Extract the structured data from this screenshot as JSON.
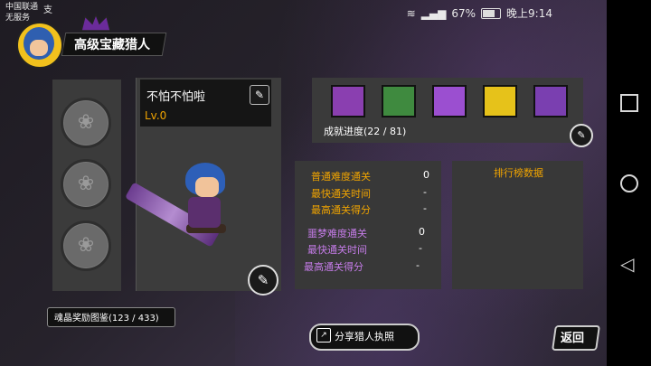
{
  "status_bar": {
    "carrier_line1": "中国联通",
    "carrier_line2": "无服务",
    "carrier_extra": "支",
    "battery": "67%",
    "time": "晚上9:14"
  },
  "header": {
    "title": "高级宝藏猎人"
  },
  "hunter": {
    "name": "不怕不怕啦",
    "level": "Lv.0"
  },
  "collection": {
    "progress": "成就进度(22 / 81)",
    "tiles": [
      {
        "icon": "castle-icon",
        "color": "#8a3fb0"
      },
      {
        "icon": "plant-monster-icon",
        "color": "#3f8a3f"
      },
      {
        "icon": "dragon-icon",
        "color": "#9b4fd0"
      },
      {
        "icon": "shield-emblem-icon",
        "color": "#e6c21a"
      },
      {
        "icon": "hundred-badge-icon",
        "color": "#7a3fb0"
      }
    ]
  },
  "stats": {
    "normal_clear_label": "普通难度通关",
    "normal_clear_value": "0",
    "normal_fast_label": "最快通关时间",
    "normal_fast_value": "-",
    "normal_score_label": "最高通关得分",
    "normal_score_value": "-",
    "nightmare_clear_label": "噩梦难度通关",
    "nightmare_clear_value": "0",
    "nightmare_fast_label": "最快通关时间",
    "nightmare_fast_value": "-",
    "nightmare_score_label": "最高通关得分",
    "nightmare_score_value": "-"
  },
  "ranking": {
    "title": "排行榜数据"
  },
  "bottom": {
    "soul_label": "魂晶奖励图鉴(123 / 433)",
    "share_label": "分享猎人执照",
    "back_label": "返回"
  },
  "colors": {
    "accent_orange": "#f0a400",
    "accent_purple": "#c57ce8"
  }
}
